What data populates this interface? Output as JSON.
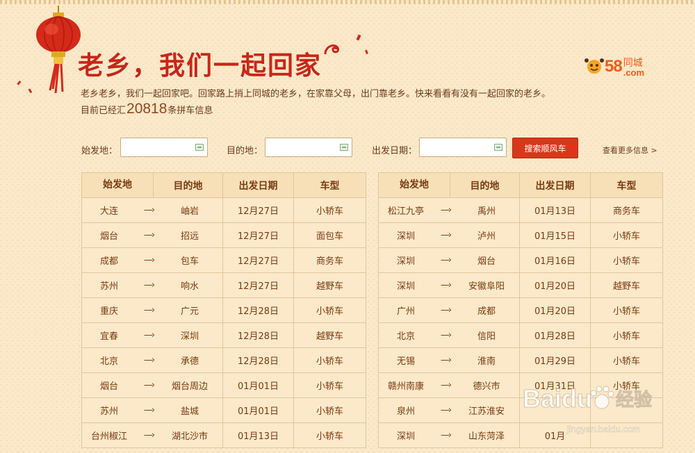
{
  "header": {
    "headline": "老乡，我们一起回家",
    "intro": "老乡老乡，我们一起回家吧。回家路上捎上同城的老乡，在家靠父母，出门靠老乡。快来看看有没有一起回家的老乡。",
    "stats_prefix": "目前已经汇",
    "stats_count": "20818",
    "stats_suffix": "条拼车信息",
    "logo_number": "58",
    "logo_cn": "同城",
    "logo_com": ".com"
  },
  "search": {
    "from_label": "始发地：",
    "from_value": "",
    "to_label": "目的地：",
    "to_value": "",
    "date_label": "出发日期：",
    "date_value": "",
    "button_label": "搜索顺风车",
    "more_link": "查看更多信息 >"
  },
  "table_headers": [
    "始发地",
    "目的地",
    "出发日期",
    "车型"
  ],
  "arrow_glyph": "—›",
  "left_rows": [
    {
      "from": "大连",
      "to": "岫岩",
      "date": "12月27日",
      "type": "小轿车"
    },
    {
      "from": "烟台",
      "to": "招远",
      "date": "12月27日",
      "type": "面包车"
    },
    {
      "from": "成都",
      "to": "包车",
      "date": "12月27日",
      "type": "商务车"
    },
    {
      "from": "苏州",
      "to": "响水",
      "date": "12月27日",
      "type": "越野车"
    },
    {
      "from": "重庆",
      "to": "广元",
      "date": "12月28日",
      "type": "小轿车"
    },
    {
      "from": "宜春",
      "to": "深圳",
      "date": "12月28日",
      "type": "越野车"
    },
    {
      "from": "北京",
      "to": "承德",
      "date": "12月28日",
      "type": "小轿车"
    },
    {
      "from": "烟台",
      "to": "烟台周边",
      "date": "01月01日",
      "type": "小轿车"
    },
    {
      "from": "苏州",
      "to": "盐城",
      "date": "01月01日",
      "type": "小轿车"
    },
    {
      "from": "台州椒江",
      "to": "湖北沙市",
      "date": "01月13日",
      "type": "小轿车"
    }
  ],
  "right_rows": [
    {
      "from": "松江九亭",
      "to": "禹州",
      "date": "01月13日",
      "type": "商务车"
    },
    {
      "from": "深圳",
      "to": "泸州",
      "date": "01月15日",
      "type": "小轿车"
    },
    {
      "from": "深圳",
      "to": "烟台",
      "date": "01月16日",
      "type": "小轿车"
    },
    {
      "from": "深圳",
      "to": "安徽阜阳",
      "date": "01月20日",
      "type": "越野车"
    },
    {
      "from": "广州",
      "to": "成都",
      "date": "01月20日",
      "type": "小轿车"
    },
    {
      "from": "北京",
      "to": "信阳",
      "date": "01月28日",
      "type": "小轿车"
    },
    {
      "from": "无锡",
      "to": "淮南",
      "date": "01月29日",
      "type": "小轿车"
    },
    {
      "from": "赣州南康",
      "to": "德兴市",
      "date": "01月31日",
      "type": "小轿车"
    },
    {
      "from": "泉州",
      "to": "江苏淮安",
      "date": "",
      "type": ""
    },
    {
      "from": "深圳",
      "to": "山东菏泽",
      "date": "01月",
      "type": ""
    }
  ],
  "watermark": {
    "brand": "Baidu",
    "cn": "经验",
    "url": "jingyan.baidu.com"
  },
  "colors": {
    "background": "#fbe9c9",
    "headline": "#c8261a",
    "text": "#7a3a12",
    "button": "#d8371a",
    "logo": "#f25b1a",
    "table_border": "#e0c59c"
  }
}
